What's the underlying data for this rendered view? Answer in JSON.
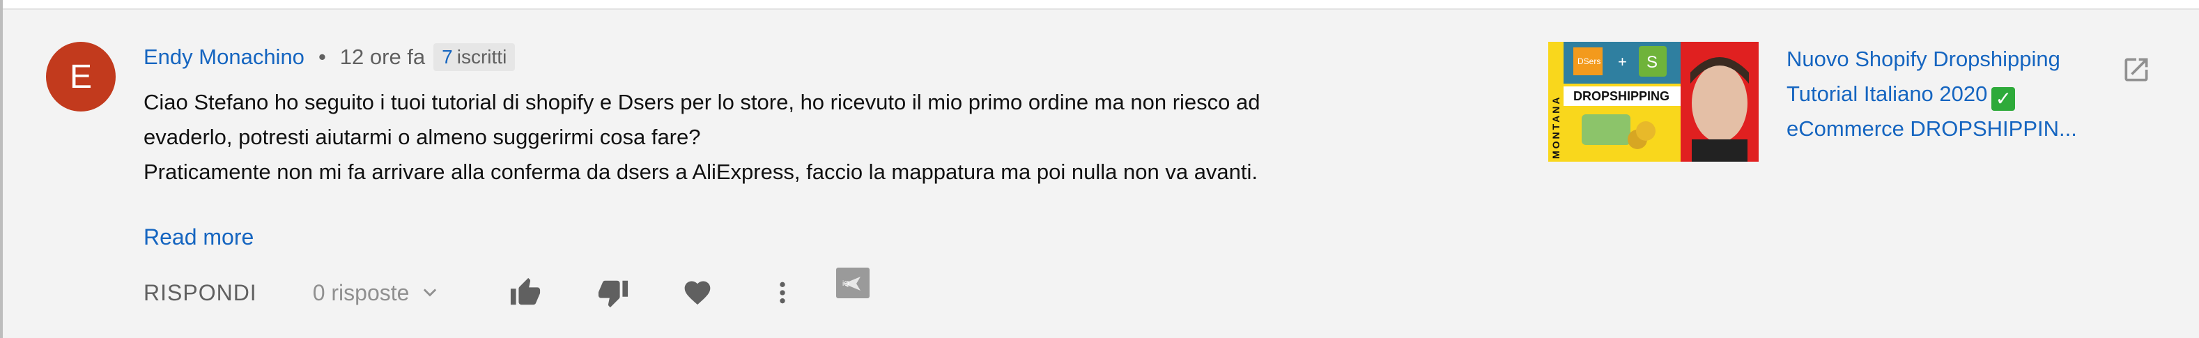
{
  "comment": {
    "avatar_letter": "E",
    "author": "Endy Monachino",
    "separator": "•",
    "time": "12 ore fa",
    "subscriber_count": "7",
    "subscriber_label": "iscritti",
    "lines": [
      "Ciao Stefano ho seguito i tuoi tutorial di shopify e Dsers per lo store, ho ricevuto il mio primo ordine ma non riesco ad",
      "evaderlo, potresti aiutarmi o almeno suggerirmi cosa fare?",
      "Praticamente non mi fa arrivare alla conferma da dsers a AliExpress, faccio la mappatura ma poi nulla non va avanti."
    ],
    "read_more": "Read more"
  },
  "actions": {
    "reply": "RISPONDI",
    "replies": "0 risposte",
    "icons": [
      "thumb-up-icon",
      "thumb-down-icon",
      "heart-icon",
      "more-vert-icon",
      "reply-arrow-icon"
    ]
  },
  "video": {
    "title_lines": [
      "Nuovo Shopify Dropshipping",
      "Tutorial Italiano 2020",
      "eCommerce DROPSHIPPIN..."
    ],
    "thumbnail_text": {
      "brand": "MONTANA",
      "dsers": "DSers",
      "plus": "+",
      "banner": "DROPSHIPPING"
    },
    "check_mark": "✓"
  },
  "colors": {
    "link_blue": "#1565c0",
    "avatar_red": "#c23a1d",
    "background": "#f3f3f3",
    "thumb_yellow": "#f9d71c",
    "thumb_red": "#e02020"
  }
}
